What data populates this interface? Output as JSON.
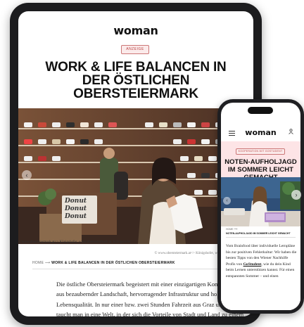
{
  "tablet": {
    "logo": "woman",
    "badge": "ANZEIGE",
    "title": "WORK & LIFE BALANCEN IN DER ÖSTLICHEN OBERSTEIERMARK",
    "caption_left": "© www.obersteiermark.at<> Königshofer, www.obersteiermark.at, Königshofer",
    "caption_right": "© www.obersteiermark.at<> Königshofer, www.obersteiermark.at",
    "breadcrumb_home": "HOME",
    "breadcrumb_arrow": "⟶",
    "breadcrumb_current": "WORK & LIFE BALANCEN IN DER ÖSTLICHEN OBERSTEIERMARK",
    "body": "Die östliche Obersteiermark begeistert mit einer einzigartigen Kombination aus bezaubernder Landschaft, hervorragender Infrastruktur und hoher Lebensqualität. In nur einer bzw. zwei Stunden Fahrzeit aus Graz und Wien taucht man in eine Welt, in der sich die Vorteile von Stadt und Land zu einem unvergleichlichen Lebensgefühl vereinen.",
    "sign_text": "Donut"
  },
  "phone": {
    "logo": "woman",
    "badge": "KOOPERATION MIT GOSTUDENT",
    "title": "NOTEN-AUFHOLJAGD IM SOMMER LEICHT GEMACHT",
    "breadcrumb_home": "HOME",
    "breadcrumb_arrow": "⟶",
    "sub": "NOTEN-AUFHOLJAGD IM SOMMER LEICHT GEMACHT",
    "body_pre": "Vom Brainfood über individuelle Lernpläne bis zur positiven Fehlerkultur: Wir haben die besten Tipps von den Wiener Nachhilfe Profis von ",
    "body_link": "GoStudent",
    "body_post": ", wie du dein Kind beim Lernen unterstützen kannst. Für einen entspannten Sommer – und einen"
  },
  "icons": {
    "menu": "menu-icon",
    "user": "user-icon",
    "prev": "chevron-left-icon",
    "next": "chevron-right-icon"
  }
}
